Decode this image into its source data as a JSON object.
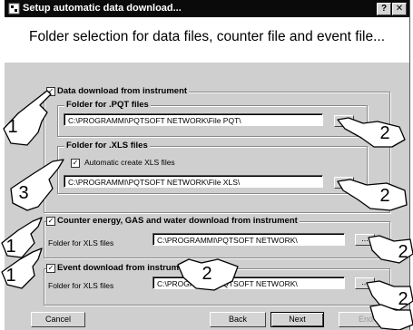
{
  "window": {
    "title": "Setup automatic data download...",
    "help_label": "?",
    "close_label": "✕"
  },
  "header": {
    "text": "Folder selection for data files, counter file and event file..."
  },
  "instrument_group": {
    "label": "Data download from instrument",
    "checked": true,
    "pqt": {
      "label": "Folder for .PQT files",
      "value": "C:\\PROGRAMMI\\PQTSOFT NETWORK\\File PQT\\",
      "browse_label": "..."
    },
    "xls": {
      "label": "Folder for .XLS files",
      "auto_create_label": "Automatic create XLS files",
      "auto_create_checked": true,
      "value": "C:\\PROGRAMMI\\PQTSOFT NETWORK\\File XLS\\",
      "browse_label": "..."
    }
  },
  "counter_group": {
    "label": "Counter energy, GAS and water download from instrument",
    "checked": true,
    "field_label": "Folder for XLS files",
    "value": "C:\\PROGRAMMI\\PQTSOFT NETWORK\\",
    "browse_label": "..."
  },
  "event_group": {
    "label": "Event download from instrument",
    "checked": true,
    "field_label": "Folder for XLS files",
    "value": "C:\\PROGRAMMI\\PQTSOFT NETWORK\\",
    "browse_label": "..."
  },
  "buttons": {
    "cancel": "Cancel",
    "back": "Back",
    "next": "Next",
    "end": "End"
  },
  "callouts": [
    "1",
    "2",
    "3",
    "2",
    "1",
    "2",
    "1",
    "2",
    "2"
  ],
  "icons": [
    "app-icon",
    "hand-pointer-icon"
  ],
  "colors": {
    "titlebar": "#0a0a0a",
    "dialog": "#cfcfcf",
    "header": "#ffffff"
  }
}
